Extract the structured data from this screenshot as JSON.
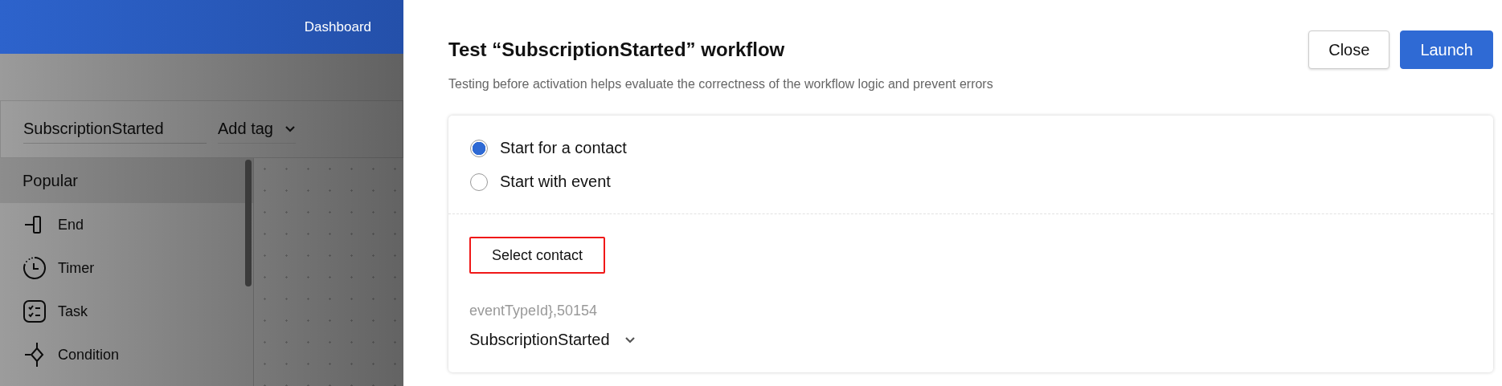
{
  "background": {
    "nav": [
      {
        "label": "Dashboard"
      }
    ],
    "workflow_name": {
      "value": "SubscriptionStarted"
    },
    "tag_select": {
      "label": "Add tag"
    },
    "palette": {
      "group": "Popular",
      "items": [
        {
          "label": "End",
          "kind": "end"
        },
        {
          "label": "Timer",
          "kind": "timer"
        },
        {
          "label": "Task",
          "kind": "task"
        },
        {
          "label": "Condition",
          "kind": "condition"
        }
      ]
    }
  },
  "drawer": {
    "title": "Test “SubscriptionStarted” workflow",
    "subtitle": "Testing before activation helps evaluate the correctness of the workflow logic and prevent errors",
    "buttons": [
      {
        "label": "Close",
        "kind": "secondary"
      },
      {
        "label": "Launch",
        "kind": "primary"
      }
    ],
    "start_options": [
      {
        "label": "Start for a contact",
        "selected": true
      },
      {
        "label": "Start with event",
        "selected": false
      }
    ],
    "select_contact_button": {
      "label": "Select contact",
      "highlighted": true
    },
    "event_field": {
      "label": "eventTypeId},50154",
      "value": "SubscriptionStarted"
    }
  }
}
